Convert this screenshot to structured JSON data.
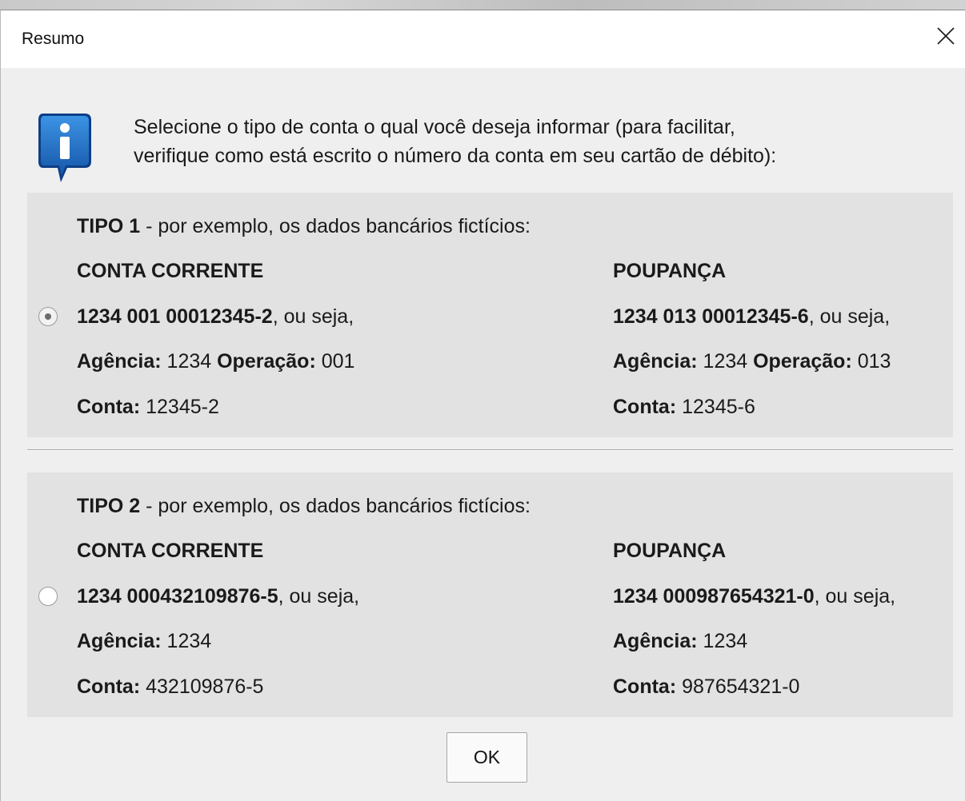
{
  "window": {
    "title": "Resumo"
  },
  "intro": {
    "line1": "Selecione o tipo de conta o qual você deseja informar (para facilitar,",
    "line2": "verifique como está escrito o número da conta em seu cartão de débito):"
  },
  "tipo1": {
    "selected": true,
    "heading_bold": "TIPO 1",
    "heading_rest": " - por exemplo, os dados bancários fictícios:",
    "corrente": {
      "title": "CONTA CORRENTE",
      "number": "1234 001 00012345-2",
      "number_suffix": ", ou seja,",
      "agencia_label": "Agência:",
      "agencia_value": " 1234 ",
      "operacao_label": "Operação:",
      "operacao_value": " 001",
      "conta_label": "Conta:",
      "conta_value": " 12345-2"
    },
    "poupanca": {
      "title": "POUPANÇA",
      "number": "1234 013 00012345-6",
      "number_suffix": ", ou seja,",
      "agencia_label": "Agência:",
      "agencia_value": " 1234 ",
      "operacao_label": "Operação:",
      "operacao_value": " 013",
      "conta_label": "Conta:",
      "conta_value": " 12345-6"
    }
  },
  "tipo2": {
    "selected": false,
    "heading_bold": "TIPO 2",
    "heading_rest": " - por exemplo, os dados bancários fictícios:",
    "corrente": {
      "title": "CONTA CORRENTE",
      "number": "1234 000432109876-5",
      "number_suffix": ", ou seja,",
      "agencia_label": "Agência:",
      "agencia_value": " 1234",
      "conta_label": "Conta:",
      "conta_value": " 432109876-5"
    },
    "poupanca": {
      "title": "POUPANÇA",
      "number": "1234 000987654321-0",
      "number_suffix": ", ou seja,",
      "agencia_label": "Agência:",
      "agencia_value": " 1234",
      "conta_label": "Conta:",
      "conta_value": " 987654321-0"
    }
  },
  "buttons": {
    "ok": "OK"
  },
  "colors": {
    "info_icon": "#1f6fc4",
    "panel_bg": "#e2e2e2",
    "dialog_bg": "#efefef"
  }
}
